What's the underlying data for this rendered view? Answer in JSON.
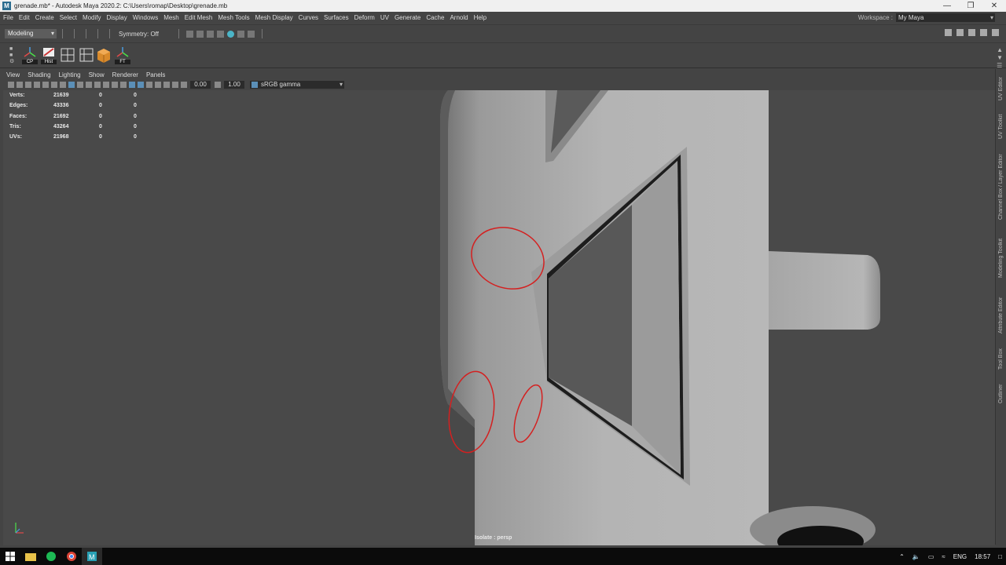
{
  "window": {
    "title": "grenade.mb* - Autodesk Maya 2020.2: C:\\Users\\romap\\Desktop\\grenade.mb",
    "app_icon": "M"
  },
  "menu": {
    "items": [
      "File",
      "Edit",
      "Create",
      "Select",
      "Modify",
      "Display",
      "Windows",
      "Mesh",
      "Edit Mesh",
      "Mesh Tools",
      "Mesh Display",
      "Curves",
      "Surfaces",
      "Deform",
      "UV",
      "Generate",
      "Cache",
      "Arnold",
      "Help"
    ],
    "workspace_label": "Workspace :",
    "workspace_value": "My Maya"
  },
  "status": {
    "mode": "Modeling",
    "symmetry": "Symmetry: Off"
  },
  "shelf": {
    "tools": [
      "CP",
      "Hist",
      "",
      "",
      "FT"
    ]
  },
  "panel": {
    "menu": [
      "View",
      "Shading",
      "Lighting",
      "Show",
      "Renderer",
      "Panels"
    ],
    "exposure": "0.00",
    "gamma_value": "1.00",
    "color_space": "sRGB gamma"
  },
  "hud": {
    "rows": [
      {
        "label": "Verts:",
        "values": [
          "21639",
          "0",
          "0"
        ]
      },
      {
        "label": "Edges:",
        "values": [
          "43336",
          "0",
          "0"
        ]
      },
      {
        "label": "Faces:",
        "values": [
          "21692",
          "0",
          "0"
        ]
      },
      {
        "label": "Tris:",
        "values": [
          "43264",
          "0",
          "0"
        ]
      },
      {
        "label": "UVs:",
        "values": [
          "21968",
          "0",
          "0"
        ]
      }
    ],
    "camera": "Isolate : persp"
  },
  "side_tabs": [
    "UV Editor",
    "UV Toolkit",
    "Channel Box / Layer Editor",
    "Modeling Toolkit",
    "Attribute Editor",
    "Tool Box",
    "Outliner"
  ],
  "taskbar": {
    "language": "ENG",
    "time": "18:57"
  },
  "colors": {
    "annotation": "#d42020",
    "viewport": "#494949",
    "ui": "#444444"
  }
}
